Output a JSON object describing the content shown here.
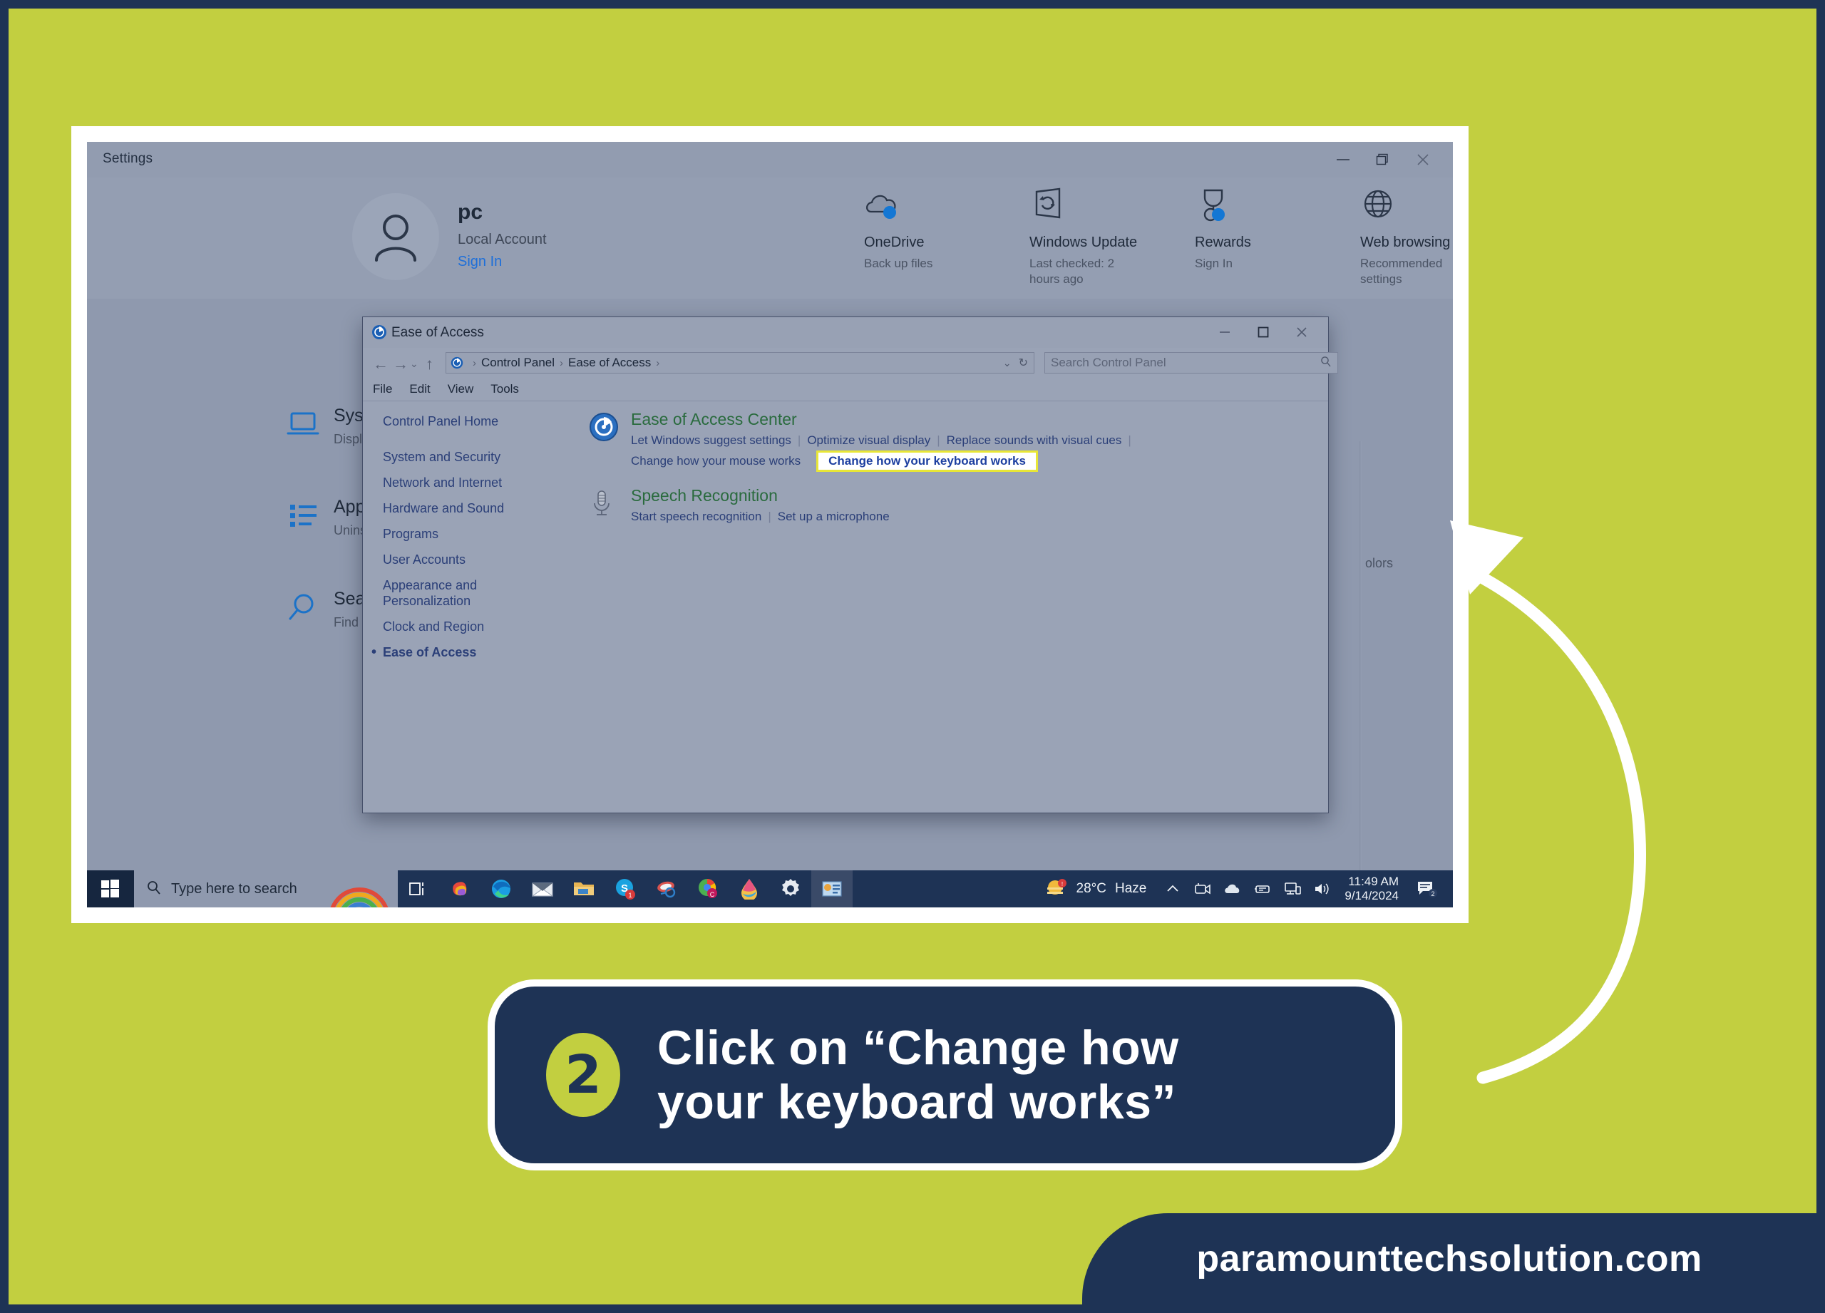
{
  "theme": {
    "background": "#c2cf40",
    "border": "#1e3355",
    "accent_navy": "#1e3355",
    "accent_lime": "#c2cf40",
    "highlight_yellow": "#e8e637"
  },
  "settings_window": {
    "title": "Settings",
    "window_buttons": [
      "minimize",
      "restore",
      "close"
    ],
    "account": {
      "name": "pc",
      "type": "Local Account",
      "link": "Sign In"
    },
    "quick_actions": [
      {
        "icon": "onedrive-icon",
        "title": "OneDrive",
        "desc": "Back up files"
      },
      {
        "icon": "windows-update-icon",
        "title": "Windows Update",
        "desc": "Last checked: 2 hours ago"
      },
      {
        "icon": "rewards-icon",
        "title": "Rewards",
        "desc": "Sign In"
      },
      {
        "icon": "web-browsing-icon",
        "title": "Web browsing",
        "desc": "Recommended settings"
      }
    ],
    "nav_tiles": [
      {
        "icon": "system-icon",
        "title": "System",
        "desc": "Display, sound, not power"
      },
      {
        "icon": "apps-icon",
        "title": "Apps",
        "desc": "Uninstall, defaults"
      },
      {
        "icon": "search-icon",
        "title": "Search",
        "desc": "Find my files, perm"
      }
    ],
    "clipped_text": "olors"
  },
  "control_panel": {
    "title": "Ease of Access",
    "window_buttons": [
      "minimize",
      "maximize",
      "close"
    ],
    "breadcrumb": [
      "Control Panel",
      "Ease of Access"
    ],
    "address_controls": {
      "dropdown": "chevron-down-icon",
      "refresh": "refresh-icon"
    },
    "search_placeholder": "Search Control Panel",
    "menu": [
      "File",
      "Edit",
      "View",
      "Tools"
    ],
    "sidebar": {
      "home": "Control Panel Home",
      "items": [
        "System and Security",
        "Network and Internet",
        "Hardware and Sound",
        "Programs",
        "User Accounts",
        "Appearance and Personalization",
        "Clock and Region",
        "Ease of Access"
      ],
      "current": "Ease of Access"
    },
    "categories": [
      {
        "icon": "ease-of-access-icon",
        "heading": "Ease of Access Center",
        "links_row1": [
          "Let Windows suggest settings",
          "Optimize visual display",
          "Replace sounds with visual cues"
        ],
        "links_row2": [
          "Change how your mouse works"
        ],
        "highlighted_link": "Change how your keyboard works"
      },
      {
        "icon": "microphone-icon",
        "heading": "Speech Recognition",
        "links_row1": [
          "Start speech recognition",
          "Set up a microphone"
        ],
        "links_row2": [],
        "highlighted_link": ""
      }
    ]
  },
  "taskbar": {
    "start_icon": "windows-start-icon",
    "search_placeholder": "Type here to search",
    "search_icon": "search-icon",
    "pinned": [
      "task-view-icon",
      "copilot-icon",
      "edge-icon",
      "mail-icon",
      "file-explorer-icon",
      "skype-icon",
      "office-icon",
      "chrome-icon",
      "paint-3d-icon",
      "settings-gear-icon",
      "powerpoint-icon"
    ],
    "weather": {
      "temperature": "28°C",
      "condition": "Haze",
      "icon": "weather-haze-icon"
    },
    "tray_icons": [
      "chevron-up-icon",
      "camera-icon",
      "onedrive-cloud-icon",
      "hardware-icon",
      "network-icon",
      "volume-icon"
    ],
    "clock": {
      "time": "11:49 AM",
      "date": "9/14/2024"
    },
    "action_center": {
      "icon": "action-center-icon",
      "badge": "2"
    }
  },
  "callout": {
    "step_number": "2",
    "line1": "Click on  “Change how",
    "line2": "your keyboard works”"
  },
  "footer": {
    "brand": "paramounttechsolution.com"
  }
}
